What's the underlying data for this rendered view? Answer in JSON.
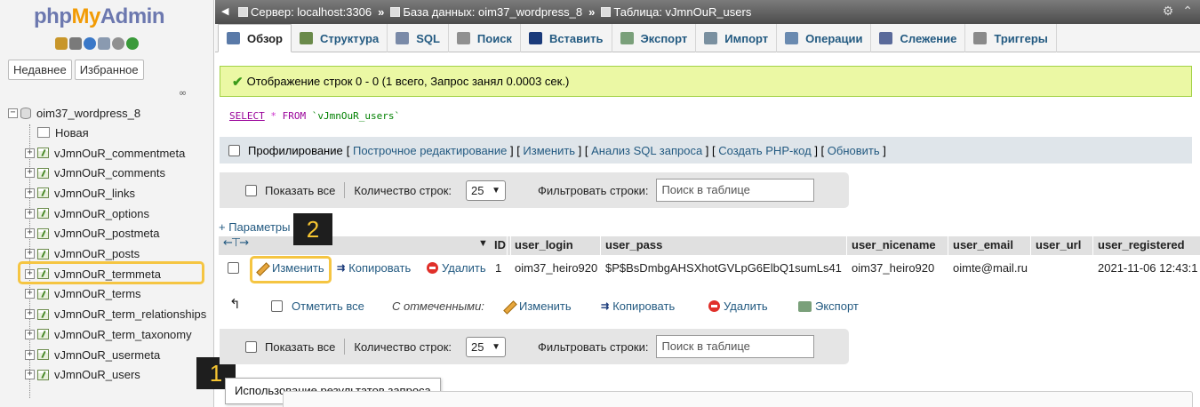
{
  "nav": {
    "logo": {
      "php": "php",
      "my": "My",
      "admin": "Admin"
    },
    "tabs": [
      "Недавнее",
      "Избранное"
    ],
    "tree": {
      "database": "oim37_wordpress_8",
      "new_label": "Новая",
      "tables": [
        "vJmnOuR_commentmeta",
        "vJmnOuR_comments",
        "vJmnOuR_links",
        "vJmnOuR_options",
        "vJmnOuR_postmeta",
        "vJmnOuR_posts",
        "vJmnOuR_termmeta",
        "vJmnOuR_terms",
        "vJmnOuR_term_relationships",
        "vJmnOuR_term_taxonomy",
        "vJmnOuR_usermeta",
        "vJmnOuR_users"
      ]
    }
  },
  "annotations": {
    "badge1": "1",
    "badge2": "2",
    "highlight_color": "#f5c542"
  },
  "tooltip": "Использование результатов запроса",
  "breadcrumb": {
    "server": "Сервер: localhost:3306",
    "database": "База данных: oim37_wordpress_8",
    "table": "Таблица: vJmnOuR_users"
  },
  "tabs": [
    {
      "label": "Обзор",
      "icon": "browse-icon",
      "active": true
    },
    {
      "label": "Структура",
      "icon": "structure-icon"
    },
    {
      "label": "SQL",
      "icon": "sql-icon"
    },
    {
      "label": "Поиск",
      "icon": "search-icon"
    },
    {
      "label": "Вставить",
      "icon": "insert-icon"
    },
    {
      "label": "Экспорт",
      "icon": "export-icon"
    },
    {
      "label": "Импорт",
      "icon": "import-icon"
    },
    {
      "label": "Операции",
      "icon": "wrench-icon"
    },
    {
      "label": "Слежение",
      "icon": "eye-icon"
    },
    {
      "label": "Триггеры",
      "icon": "triggers-icon"
    }
  ],
  "success": "Отображение строк 0 - 0 (1 всего, Запрос занял 0.0003 сек.)",
  "sql": {
    "select": "SELECT",
    "star": "*",
    "from": "FROM",
    "table": "`vJmnOuR_users`"
  },
  "profiling": {
    "label": "Профилирование",
    "links": [
      "Построчное редактирование",
      "Изменить",
      "Анализ SQL запроса",
      "Создать PHP-код",
      "Обновить"
    ]
  },
  "navbar": {
    "show_all": "Показать все",
    "rows_label": "Количество строк:",
    "rows_value": "25",
    "filter_label": "Фильтровать строки:",
    "filter_placeholder": "Поиск в таблице"
  },
  "params": "+ Параметры",
  "table": {
    "headers": [
      "ID",
      "user_login",
      "user_pass",
      "user_nicename",
      "user_email",
      "user_url",
      "user_registered"
    ],
    "row": {
      "edit": "Изменить",
      "copy": "Копировать",
      "delete": "Удалить",
      "cells": [
        "1",
        "oim37_heiro920",
        "$P$BsDmbgAHSXhotGVLpG6ElbQ1sumLs41",
        "oim37_heiro920",
        "oimte@mail.ru",
        "",
        "2021-11-06 12:43:1"
      ]
    }
  },
  "bulk": {
    "check_all": "Отметить все",
    "with_selected": "С отмеченными:",
    "edit": "Изменить",
    "copy": "Копировать",
    "delete": "Удалить",
    "export": "Экспорт"
  }
}
